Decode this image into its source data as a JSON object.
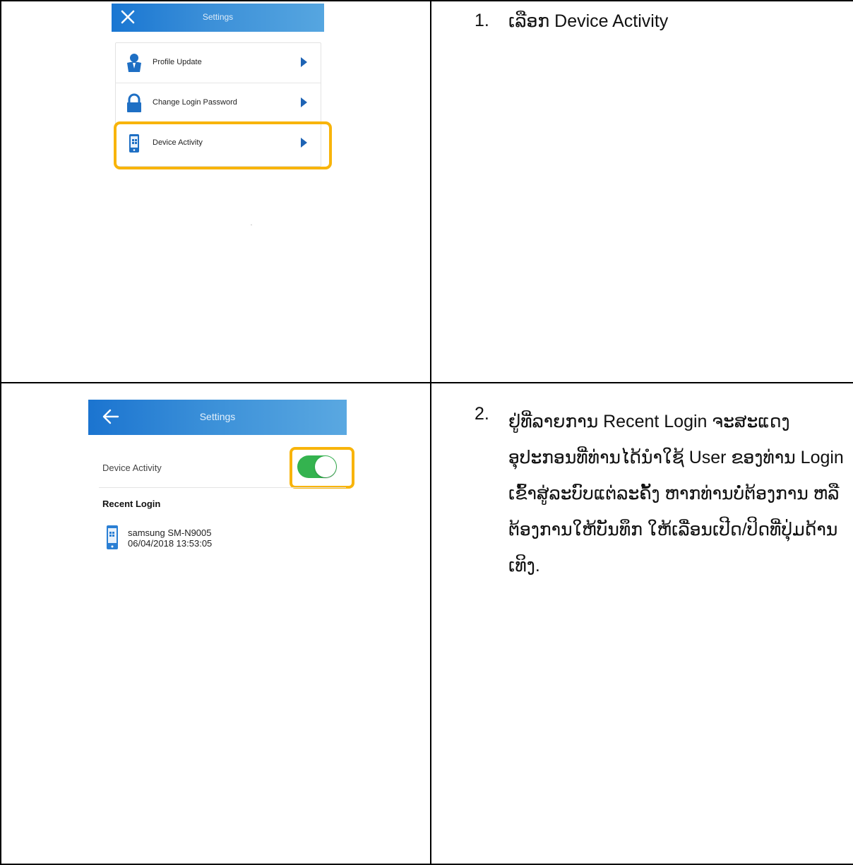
{
  "step1": {
    "number": "1.",
    "text": "ເລືອກ Device Activity",
    "screenshot": {
      "header_title": "Settings",
      "close_icon": "close-icon",
      "menu_items": [
        {
          "label": "Profile Update",
          "icon": "profile-icon"
        },
        {
          "label": "Change Login Password",
          "icon": "lock-icon"
        },
        {
          "label": "Device Activity",
          "icon": "device-icon"
        }
      ],
      "highlight_color": "#f8b40a"
    }
  },
  "step2": {
    "number": "2.",
    "text": "ຢູ່ທີ່ລາຍການ Recent Login ຈະສະແດງ ອຸປະກອນທີ່ທ່ານໄດ້ນຳໃຊ້ User ຂອງທ່ານ Login ເຂົ້າສູ່ລະບົບແຕ່ລະຄັ້ງ ຫາກທ່ານບໍ່ຕ້ອງການ ຫລື ຕ້ອງການໃຫ້ບັນທຶກ ໃຫ້ເລື່ອນເປີດ/ປິດທີ່ປຸ່ມດ້ານເທິງ.",
    "screenshot": {
      "header_title": "Settings",
      "back_icon": "back-arrow-icon",
      "device_activity_label": "Device Activity",
      "toggle_on": true,
      "toggle_color": "#34b34f",
      "recent_login_heading": "Recent Login",
      "device_name": "samsung SM-N9005",
      "device_time": "06/04/2018 13:53:05"
    }
  }
}
